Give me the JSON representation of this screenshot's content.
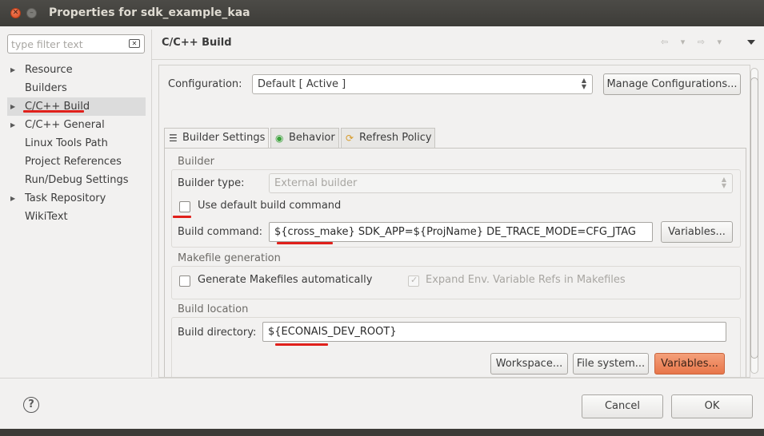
{
  "window": {
    "title": "Properties for sdk_example_kaa",
    "close_glyph": "✕",
    "minimize_glyph": "–"
  },
  "filter": {
    "placeholder": "type filter text",
    "clear_glyph": "✕"
  },
  "tree": {
    "items": [
      {
        "label": "Resource",
        "expandable": true
      },
      {
        "label": "Builders",
        "expandable": false
      },
      {
        "label": "C/C++ Build",
        "expandable": true,
        "selected": true
      },
      {
        "label": "C/C++ General",
        "expandable": true
      },
      {
        "label": "Linux Tools Path",
        "expandable": false
      },
      {
        "label": "Project References",
        "expandable": false
      },
      {
        "label": "Run/Debug Settings",
        "expandable": false
      },
      {
        "label": "Task Repository",
        "expandable": true
      },
      {
        "label": "WikiText",
        "expandable": false
      }
    ]
  },
  "page": {
    "title": "C/C++ Build",
    "nav_back": "⇦ ▾",
    "nav_forward": "⇨ ▾"
  },
  "configuration": {
    "label": "Configuration:",
    "value": "Default  [ Active ]",
    "manage_button": "Manage Configurations..."
  },
  "tabs": [
    {
      "label": "Builder Settings",
      "icon": "☰",
      "active": true
    },
    {
      "label": "Behavior",
      "icon": "◉",
      "active": false
    },
    {
      "label": "Refresh Policy",
      "icon": "⟳",
      "active": false
    }
  ],
  "builder": {
    "group_title": "Builder",
    "type_label": "Builder type:",
    "type_value": "External builder",
    "use_default_label": "Use default build command",
    "use_default_checked": false,
    "command_label": "Build command:",
    "command_value": "${cross_make} SDK_APP=${ProjName} DE_TRACE_MODE=CFG_JTAG",
    "variables_button": "Variables..."
  },
  "makefile": {
    "group_title": "Makefile generation",
    "generate_label": "Generate Makefiles automatically",
    "generate_checked": false,
    "expand_label": "Expand Env. Variable Refs in Makefiles",
    "expand_checked": true
  },
  "location": {
    "group_title": "Build location",
    "dir_label": "Build directory:",
    "dir_value": "${ECONAIS_DEV_ROOT}",
    "workspace_button": "Workspace...",
    "filesystem_button": "File system...",
    "variables_button": "Variables..."
  },
  "footer": {
    "help_glyph": "?",
    "cancel_button": "Cancel",
    "ok_button": "OK"
  },
  "colors": {
    "annotation_red": "#e0201b",
    "accent_orange": "#e8764a"
  }
}
